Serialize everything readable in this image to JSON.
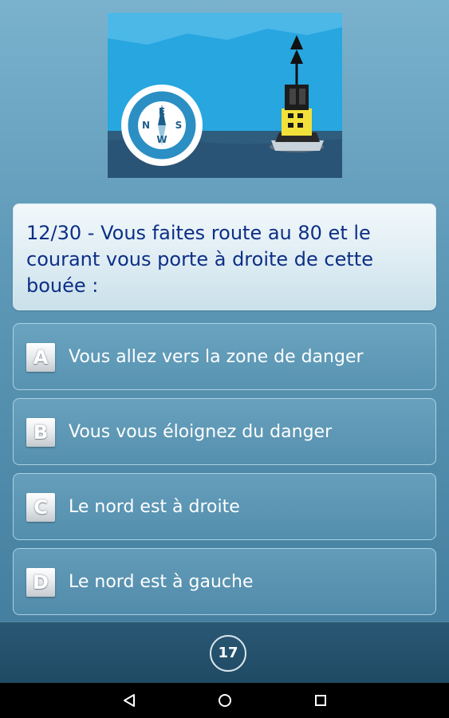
{
  "illustration": {
    "icon": "compass-and-cardinal-buoy-illustration",
    "compass_letters": {
      "n": "N",
      "e": "E",
      "s": "S",
      "w": "W"
    }
  },
  "question": {
    "text": "12/30 - Vous faites route au 80 et le courant vous porte à droite de cette bouée :"
  },
  "answers": [
    {
      "letter": "A",
      "text": "Vous allez vers la zone de danger"
    },
    {
      "letter": "B",
      "text": "Vous vous éloignez du danger"
    },
    {
      "letter": "C",
      "text": "Le nord est à droite"
    },
    {
      "letter": "D",
      "text": "Le nord est à gauche"
    }
  ],
  "footer": {
    "timer": "17"
  },
  "nav": {
    "back_icon": "back-triangle-icon",
    "home_icon": "home-circle-icon",
    "recents_icon": "recents-square-icon"
  },
  "colors": {
    "question_text": "#0d2f86",
    "answer_text": "#ffffff",
    "buoy_yellow": "#f2e13a",
    "sea": "#2f5d7e"
  }
}
